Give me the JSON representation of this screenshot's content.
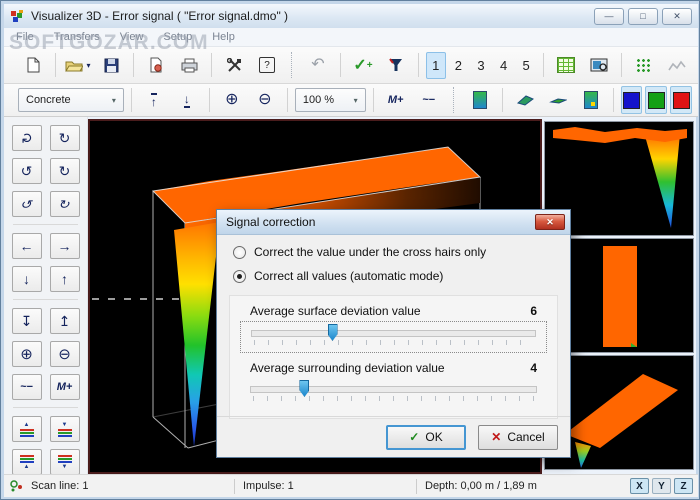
{
  "window": {
    "title": "Visualizer 3D - Error signal ( \"Error signal.dmo\" )",
    "minimize": "—",
    "maximize": "□",
    "close": "✕"
  },
  "watermark": "SOFTGOZAR.COM",
  "menu": {
    "items": [
      "File",
      "Transfers",
      "View",
      "Setup",
      "Help"
    ]
  },
  "toolbar": {
    "material": "Concrete",
    "zoom_level": "100 %",
    "pages": [
      "1",
      "2",
      "3",
      "4",
      "5"
    ],
    "active_page": "1",
    "glyphs": {
      "open_arrow": "▾",
      "combo_arrow": "▾",
      "help": "?",
      "undo": "↶",
      "add_check": "✓",
      "add_plus": "+",
      "to_top": "↑",
      "to_bottom": "↓",
      "zoom_in": "⊕",
      "zoom_out": "⊖",
      "peak_add": "M+",
      "wave_minus": "~−"
    },
    "colors": {
      "blue": "#1414cc",
      "green": "#14a014",
      "red": "#e01414"
    }
  },
  "sidebar": {
    "buttons": [
      {
        "name": "rotate-vertical",
        "glyph": "↻"
      },
      {
        "name": "rotate-horizontal",
        "glyph": "↻"
      },
      {
        "name": "rotate-left",
        "glyph": "↺"
      },
      {
        "name": "rotate-right",
        "glyph": "↻"
      },
      {
        "name": "tilt-left",
        "glyph": "↺"
      },
      {
        "name": "tilt-right",
        "glyph": "↻"
      },
      {
        "name": "move-left",
        "glyph": "←"
      },
      {
        "name": "move-right",
        "glyph": "→"
      },
      {
        "name": "move-down",
        "glyph": "↓"
      },
      {
        "name": "move-up",
        "glyph": "↑"
      },
      {
        "name": "to-bottom",
        "glyph": "↧"
      },
      {
        "name": "to-top",
        "glyph": "↥"
      },
      {
        "name": "zoom-in",
        "glyph": "⊕"
      },
      {
        "name": "zoom-out",
        "glyph": "⊖"
      },
      {
        "name": "wave-minus",
        "glyph": "~−"
      },
      {
        "name": "peak-plus",
        "glyph": "M+"
      },
      {
        "name": "layer-up-top",
        "glyph": "▲"
      },
      {
        "name": "layer-down-top",
        "glyph": "▼"
      },
      {
        "name": "layer-up-bottom",
        "glyph": "▲"
      },
      {
        "name": "layer-down-bottom",
        "glyph": "▼"
      }
    ]
  },
  "dialog": {
    "title": "Signal correction",
    "close": "✕",
    "options": [
      {
        "label": "Correct the value under the cross hairs only",
        "selected": false
      },
      {
        "label": "Correct all values (automatic mode)",
        "selected": true
      }
    ],
    "sliders": [
      {
        "label": "Average surface deviation value",
        "value": "6",
        "percent": 30
      },
      {
        "label": "Average surrounding deviation value",
        "value": "4",
        "percent": 21
      }
    ],
    "ok_icon": "✓",
    "ok_label": "OK",
    "cancel_icon": "✕",
    "cancel_label": "Cancel"
  },
  "statusbar": {
    "scan_line": "Scan line: 1",
    "impulse": "Impulse: 1",
    "depth": "Depth: 0,00 m / 1,89 m",
    "axes": [
      "X",
      "Y",
      "Z"
    ]
  }
}
